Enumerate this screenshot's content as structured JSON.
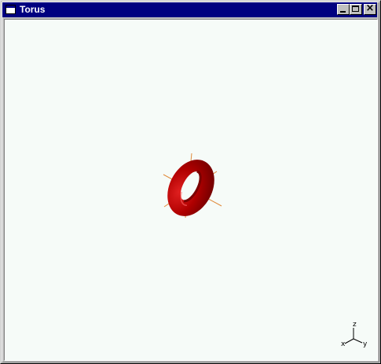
{
  "window": {
    "title": "Torus",
    "controls": {
      "minimize": "minimize",
      "maximize": "maximize",
      "close": "close"
    }
  },
  "viewport": {
    "background": "#f6fbf8",
    "object": {
      "name": "torus",
      "color": "#b00000"
    },
    "axes_indicator": {
      "x_label": "x",
      "y_label": "y",
      "z_label": "z"
    }
  }
}
